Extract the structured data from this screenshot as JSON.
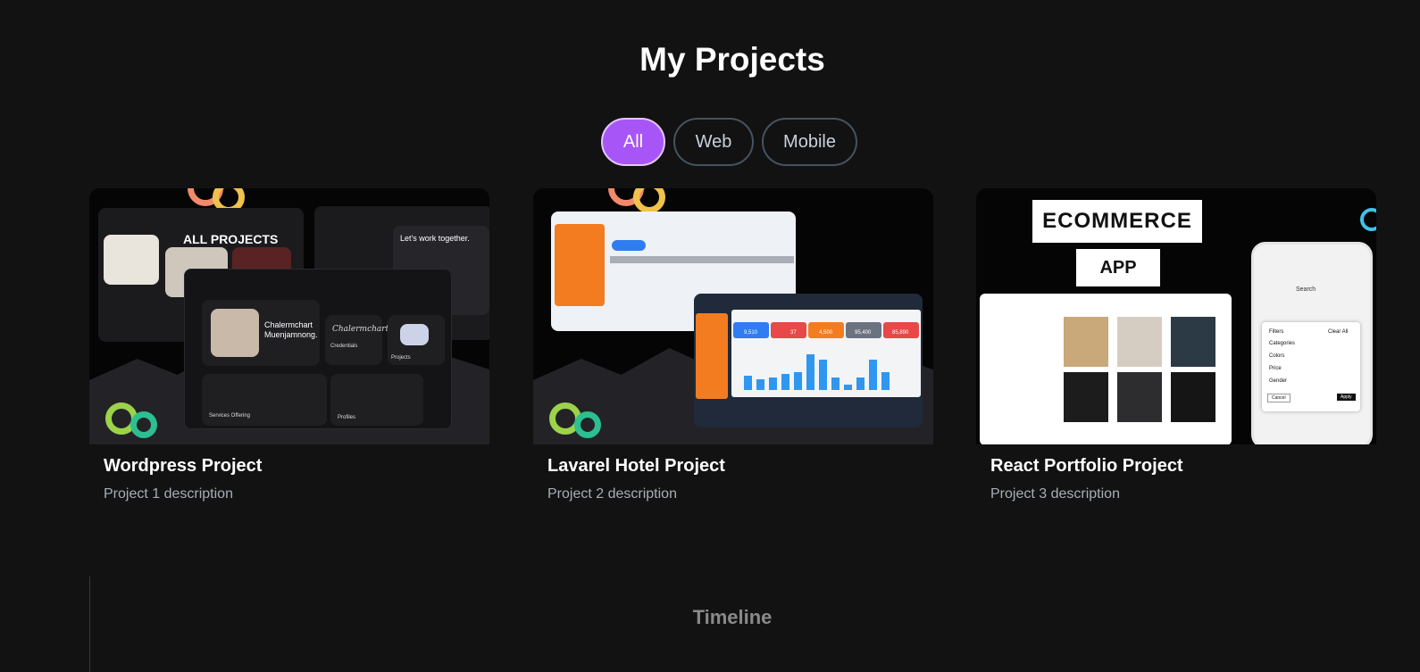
{
  "page_title": "My Projects",
  "filters": [
    {
      "label": "All",
      "active": true
    },
    {
      "label": "Web",
      "active": false
    },
    {
      "label": "Mobile",
      "active": false
    }
  ],
  "projects": [
    {
      "title": "Wordpress Project",
      "description": "Project 1 description",
      "thumb_text": {
        "heading": "ALL PROJECTS",
        "name": "Chalermchart Muenjamnong.",
        "contact": "Let's work together.",
        "credentials": "Credentials",
        "projects": "Projects",
        "services": "Services Offering",
        "profiles": "Profiles",
        "signature": "Chalermchart"
      }
    },
    {
      "title": "Lavarel Hotel Project",
      "description": "Project 2 description",
      "thumb_text": {
        "stats": [
          "9,510",
          "37",
          "4,500",
          "95,400",
          "85,890"
        ]
      }
    },
    {
      "title": "React Portfolio Project",
      "description": "Project 3 description",
      "thumb_text": {
        "badge1": "ECOMMERCE",
        "badge2": "APP",
        "search": "Search",
        "filters": "Filters",
        "clear": "Clear All",
        "categories": "Categories",
        "colors": "Colors",
        "price": "Price",
        "gender": "Gender",
        "cancel": "Cancel",
        "apply": "Apply"
      }
    }
  ],
  "timeline_title": "Timeline",
  "colors": {
    "accent": "#a855f7",
    "background": "#121212"
  }
}
